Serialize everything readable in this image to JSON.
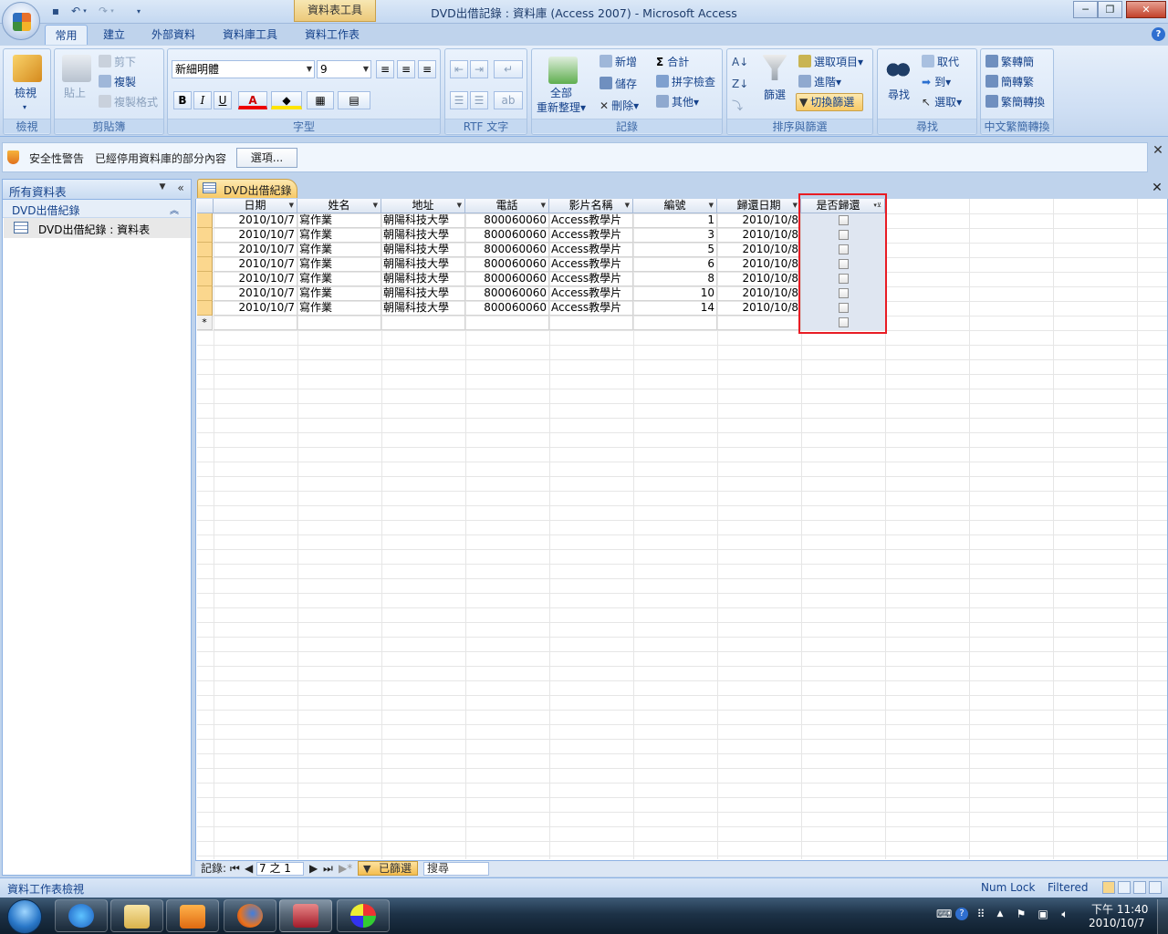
{
  "window": {
    "title": "DVD出借記錄 : 資料庫 (Access 2007) - Microsoft Access",
    "context_tab": "資料表工具"
  },
  "tabs": [
    "常用",
    "建立",
    "外部資料",
    "資料庫工具",
    "資料工作表"
  ],
  "ribbon": {
    "views": {
      "view": "檢視",
      "label": "檢視"
    },
    "clipboard": {
      "paste": "貼上",
      "cut": "剪下",
      "copy": "複製",
      "format_painter": "複製格式",
      "label": "剪貼簿"
    },
    "font": {
      "font_name": "新細明體",
      "font_size": "9",
      "bold": "B",
      "italic": "I",
      "underline": "U",
      "label": "字型"
    },
    "rtf": {
      "label": "RTF 文字"
    },
    "records": {
      "refresh": "全部",
      "refresh2": "重新整理",
      "new": "新增",
      "save": "儲存",
      "delete": "刪除",
      "totals": "合計",
      "spelling": "拼字檢查",
      "more": "其他",
      "label": "記錄"
    },
    "sort_filter": {
      "filter": "篩選",
      "selection": "選取項目",
      "advanced": "進階",
      "toggle": "切換篩選",
      "label": "排序與篩選"
    },
    "find": {
      "find": "尋找",
      "replace": "取代",
      "goto": "到",
      "select": "選取",
      "label": "尋找"
    },
    "chinese": {
      "t2s": "繁轉簡",
      "s2t": "簡轉繁",
      "convert": "繁簡轉換",
      "label": "中文繁簡轉換"
    }
  },
  "security_bar": {
    "title": "安全性警告",
    "message": "已經停用資料庫的部分內容",
    "options_button": "選項..."
  },
  "nav_pane": {
    "title": "所有資料表",
    "group": "DVD出借紀錄",
    "item": "DVD出借紀錄 : 資料表"
  },
  "document": {
    "tab_label": "DVD出借紀錄"
  },
  "table": {
    "columns": [
      "日期",
      "姓名",
      "地址",
      "電話",
      "影片名稱",
      "編號",
      "歸還日期",
      "是否歸還"
    ],
    "rows": [
      [
        "2010/10/7",
        "寫作業",
        "朝陽科技大學",
        "800060060",
        "Access教學片",
        "1",
        "2010/10/8",
        false
      ],
      [
        "2010/10/7",
        "寫作業",
        "朝陽科技大學",
        "800060060",
        "Access教學片",
        "3",
        "2010/10/8",
        false
      ],
      [
        "2010/10/7",
        "寫作業",
        "朝陽科技大學",
        "800060060",
        "Access教學片",
        "5",
        "2010/10/8",
        false
      ],
      [
        "2010/10/7",
        "寫作業",
        "朝陽科技大學",
        "800060060",
        "Access教學片",
        "6",
        "2010/10/8",
        false
      ],
      [
        "2010/10/7",
        "寫作業",
        "朝陽科技大學",
        "800060060",
        "Access教學片",
        "8",
        "2010/10/8",
        false
      ],
      [
        "2010/10/7",
        "寫作業",
        "朝陽科技大學",
        "800060060",
        "Access教學片",
        "10",
        "2010/10/8",
        false
      ],
      [
        "2010/10/7",
        "寫作業",
        "朝陽科技大學",
        "800060060",
        "Access教學片",
        "14",
        "2010/10/8",
        false
      ]
    ],
    "new_row_marker": "*"
  },
  "record_nav": {
    "label": "記錄:",
    "position": "7 之 1",
    "filtered": "已篩選",
    "search": "搜尋"
  },
  "status_bar": {
    "left": "資料工作表檢視",
    "numlock": "Num Lock",
    "filtered": "Filtered"
  },
  "taskbar": {
    "time": "下午 11:40",
    "date": "2010/10/7"
  },
  "colors": {
    "accent": "#15428b",
    "highlight": "#e81c24",
    "record_selector": "#fbd78e"
  }
}
